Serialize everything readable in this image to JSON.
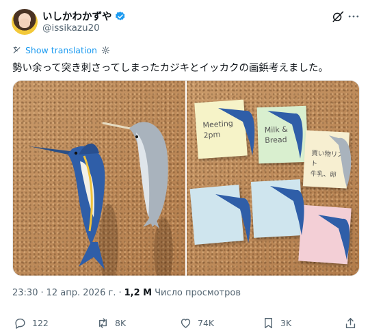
{
  "author": {
    "display_name": "いしかわかずや",
    "handle": "@issikazu20",
    "verified": true
  },
  "translate": {
    "label": "Show translation"
  },
  "post": {
    "text": "勢い余って突き刺さってしまったカジキとイッカクの画鋲考えました。"
  },
  "media": {
    "notes": [
      {
        "lines": [
          "Meeting",
          "2pm"
        ],
        "color": "#f6f3c8"
      },
      {
        "lines": [
          "Milk &",
          "Bread"
        ],
        "color": "#d9efcf"
      },
      {
        "lines": [
          "買い物リスト",
          "牛乳、卵"
        ],
        "color": "#f7efd1"
      },
      {
        "lines": [],
        "color": "#cfe5ee"
      },
      {
        "lines": [],
        "color": "#cfe5ee"
      },
      {
        "lines": [],
        "color": "#f3cfd6"
      }
    ]
  },
  "meta": {
    "time": "23:30",
    "separator": "·",
    "date": "12 апр. 2026 г.",
    "views_count": "1,2 M",
    "views_label": "Число просмотров"
  },
  "actions": {
    "replies": "122",
    "reposts": "8K",
    "likes": "74K",
    "bookmarks": "3K"
  },
  "colors": {
    "accent": "#1d9bf0",
    "text": "#0f1419",
    "secondary": "#536471"
  }
}
